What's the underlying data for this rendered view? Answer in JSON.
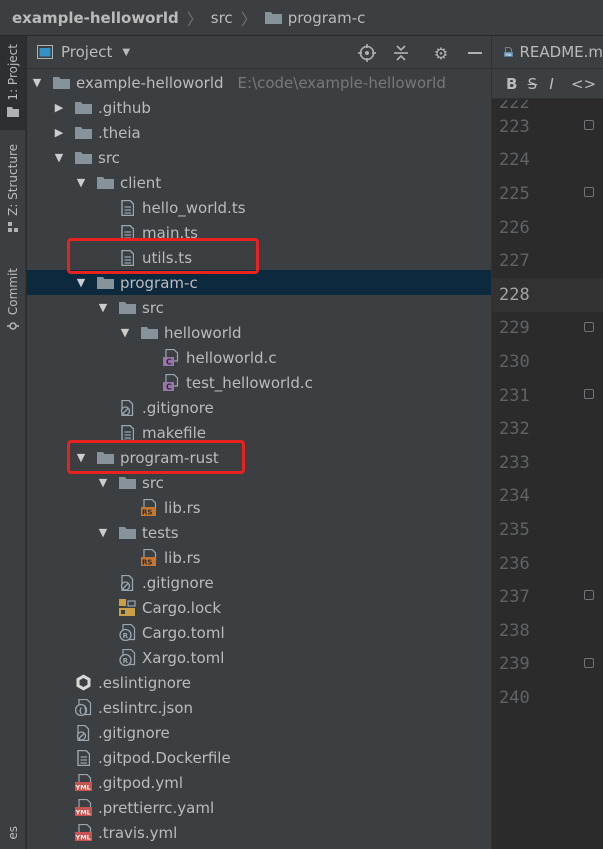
{
  "breadcrumb": {
    "items": [
      "example-helloworld",
      "src",
      "program-c"
    ]
  },
  "left_strip": {
    "tabs": [
      "1: Project",
      "Z: Structure",
      "Commit"
    ],
    "bottom_partial": "es"
  },
  "project_panel": {
    "title": "Project",
    "root_path": "E:\\code\\example-helloworld"
  },
  "tree": [
    {
      "label": "example-helloworld",
      "type": "folder",
      "expanded": true
    },
    {
      "label": ".github",
      "type": "folder",
      "expanded": false
    },
    {
      "label": ".theia",
      "type": "folder",
      "expanded": false
    },
    {
      "label": "src",
      "type": "folder",
      "expanded": true
    },
    {
      "label": "client",
      "type": "folder",
      "expanded": true
    },
    {
      "label": "hello_world.ts",
      "type": "ts"
    },
    {
      "label": "main.ts",
      "type": "ts"
    },
    {
      "label": "utils.ts",
      "type": "ts"
    },
    {
      "label": "program-c",
      "type": "folder",
      "expanded": true
    },
    {
      "label": "src",
      "type": "folder",
      "expanded": true
    },
    {
      "label": "helloworld",
      "type": "folder",
      "expanded": true
    },
    {
      "label": "helloworld.c",
      "type": "c"
    },
    {
      "label": "test_helloworld.c",
      "type": "c"
    },
    {
      "label": ".gitignore",
      "type": "gitignore"
    },
    {
      "label": "makefile",
      "type": "text"
    },
    {
      "label": "program-rust",
      "type": "folder",
      "expanded": true
    },
    {
      "label": "src",
      "type": "folder",
      "expanded": true
    },
    {
      "label": "lib.rs",
      "type": "rs"
    },
    {
      "label": "tests",
      "type": "folder",
      "expanded": true
    },
    {
      "label": "lib.rs",
      "type": "rs"
    },
    {
      "label": ".gitignore",
      "type": "gitignore"
    },
    {
      "label": "Cargo.lock",
      "type": "lock"
    },
    {
      "label": "Cargo.toml",
      "type": "toml"
    },
    {
      "label": "Xargo.toml",
      "type": "toml"
    },
    {
      "label": ".eslintignore",
      "type": "eslintignore"
    },
    {
      "label": ".eslintrc.json",
      "type": "json"
    },
    {
      "label": ".gitignore",
      "type": "gitignore"
    },
    {
      "label": ".gitpod.Dockerfile",
      "type": "text"
    },
    {
      "label": ".gitpod.yml",
      "type": "yml"
    },
    {
      "label": ".prettierrc.yaml",
      "type": "yml"
    },
    {
      "label": ".travis.yml",
      "type": "yml"
    }
  ],
  "editor": {
    "tab_label": "README.m",
    "tab_badge": "MD",
    "toolbar": [
      "B",
      "S",
      "I",
      "<>"
    ],
    "line_numbers": [
      "222",
      "223",
      "224",
      "225",
      "226",
      "227",
      "228",
      "229",
      "230",
      "231",
      "232",
      "233",
      "234",
      "235",
      "236",
      "237",
      "238",
      "239",
      "240"
    ],
    "current_line": "228"
  },
  "colors": {
    "selection": "#0d293e",
    "highlight_box": "#e8231f",
    "folder": "#87939a",
    "c_badge": "#9876aa",
    "rs_badge": "#c57633",
    "yml_badge": "#c75450"
  },
  "icons": {
    "panel_header": [
      "project-view-icon",
      "dropdown-icon",
      "locate-icon",
      "collapse-all-icon",
      "settings-gear-icon",
      "hide-panel-icon"
    ]
  }
}
